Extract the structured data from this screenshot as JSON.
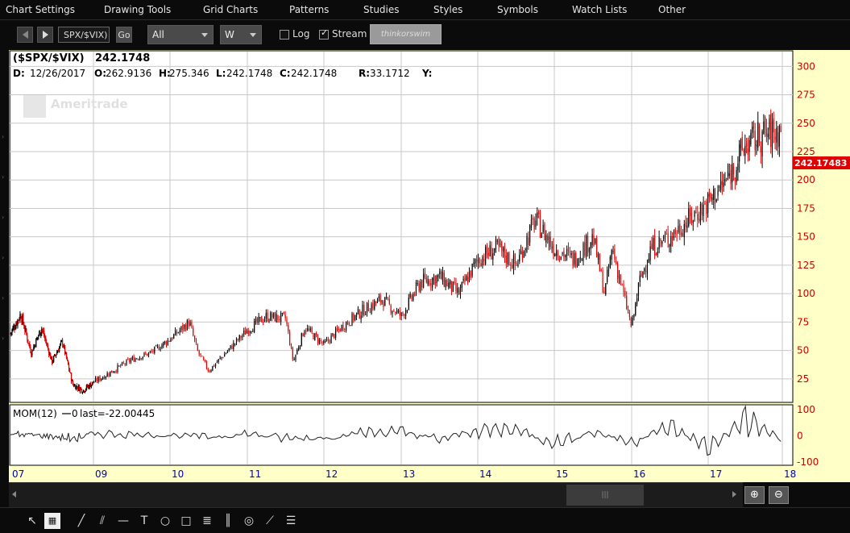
{
  "menu": [
    "Chart Settings",
    "Drawing Tools",
    "Grid Charts",
    "Patterns",
    "Studies",
    "Styles",
    "Symbols",
    "Watch Lists",
    "Other"
  ],
  "toolbar": {
    "symbol": "SPX/$VIX)",
    "go_label": "Go",
    "timeframe": "All",
    "aggregation": "W",
    "log_label": "Log",
    "log_checked": false,
    "stream_label": "Stream",
    "stream_checked": true,
    "brand": "thinkorswim"
  },
  "chart_header": {
    "symbol_title": "($SPX/$VIX)",
    "last_value": "242.1748",
    "d_label": "D:",
    "date": "12/26/2017",
    "o_label": "O:",
    "open": "262.9136",
    "h_label": "H:",
    "high": "275.346",
    "l_label": "L:",
    "low": "242.1748",
    "c_label": "C:",
    "close": "242.1748",
    "r_label": "R:",
    "range": "33.1712",
    "y_label": "Y:",
    "watermark": "Ameritrade"
  },
  "price_marker": "242.17483",
  "study": {
    "label": "MOM(12)",
    "zero_text": "0",
    "last_text": "last=-22.00445"
  },
  "colors": {
    "chart_bg": "#ffffc8",
    "up": "#000000",
    "down": "#e00000",
    "axis_text": "#d00000",
    "date_text": "#0000c0",
    "marker_bg": "#e00000"
  },
  "chart_data": [
    {
      "type": "candlestick",
      "title": "($SPX/$VIX)",
      "xlabel": "",
      "ylabel": "",
      "x_tick_labels": [
        "07",
        "09",
        "10",
        "11",
        "12",
        "13",
        "14",
        "15",
        "16",
        "17",
        "18"
      ],
      "y_ticks": [
        25,
        50,
        75,
        100,
        125,
        150,
        175,
        200,
        225,
        250,
        275,
        300
      ],
      "ylim": [
        5,
        313
      ],
      "grid": true,
      "scale": "linear",
      "series": [
        {
          "x": [
            2007.0,
            2007.25,
            2007.5,
            2007.75,
            2008.0,
            2008.25,
            2008.5,
            2008.75,
            2009.0,
            2009.25,
            2009.5,
            2009.75,
            2010.0,
            2010.25,
            2010.35,
            2010.5,
            2010.75,
            2011.0,
            2011.25,
            2011.5,
            2011.6,
            2011.75,
            2012.0,
            2012.25,
            2012.5,
            2012.75,
            2013.0,
            2013.25,
            2013.5,
            2013.75,
            2014.0,
            2014.25,
            2014.5,
            2014.75,
            2015.0,
            2015.25,
            2015.5,
            2015.65,
            2015.75,
            2016.0,
            2016.1,
            2016.25,
            2016.5,
            2016.75,
            2017.0,
            2017.25,
            2017.5,
            2017.75,
            2017.98
          ],
          "close": [
            65,
            82,
            48,
            70,
            40,
            58,
            20,
            15,
            22,
            32,
            42,
            48,
            60,
            75,
            50,
            32,
            50,
            68,
            80,
            78,
            40,
            70,
            55,
            72,
            85,
            95,
            80,
            110,
            115,
            100,
            130,
            140,
            125,
            165,
            140,
            130,
            150,
            100,
            140,
            70,
            110,
            140,
            150,
            165,
            180,
            200,
            230,
            240,
            242.17
          ]
        }
      ]
    },
    {
      "type": "line",
      "title": "MOM(12)",
      "xlabel": "",
      "ylabel": "",
      "x_tick_labels": [
        "07",
        "09",
        "10",
        "11",
        "12",
        "13",
        "14",
        "15",
        "16",
        "17",
        "18"
      ],
      "y_ticks": [
        100,
        0,
        -100
      ],
      "ylim": [
        -110,
        115
      ],
      "grid": false,
      "series": [
        {
          "name": "MOM(12)",
          "x": [
            2007.0,
            2007.5,
            2008.0,
            2008.5,
            2009.0,
            2009.5,
            2010.0,
            2010.5,
            2011.0,
            2011.5,
            2012.0,
            2012.5,
            2013.0,
            2013.5,
            2014.0,
            2014.5,
            2015.0,
            2015.5,
            2016.0,
            2016.5,
            2017.0,
            2017.5,
            2017.98
          ],
          "values": [
            10,
            5,
            -5,
            -25,
            15,
            10,
            5,
            -10,
            15,
            -20,
            -15,
            25,
            30,
            -30,
            40,
            50,
            -60,
            30,
            -50,
            70,
            -90,
            120,
            -22.00445
          ]
        }
      ]
    }
  ]
}
